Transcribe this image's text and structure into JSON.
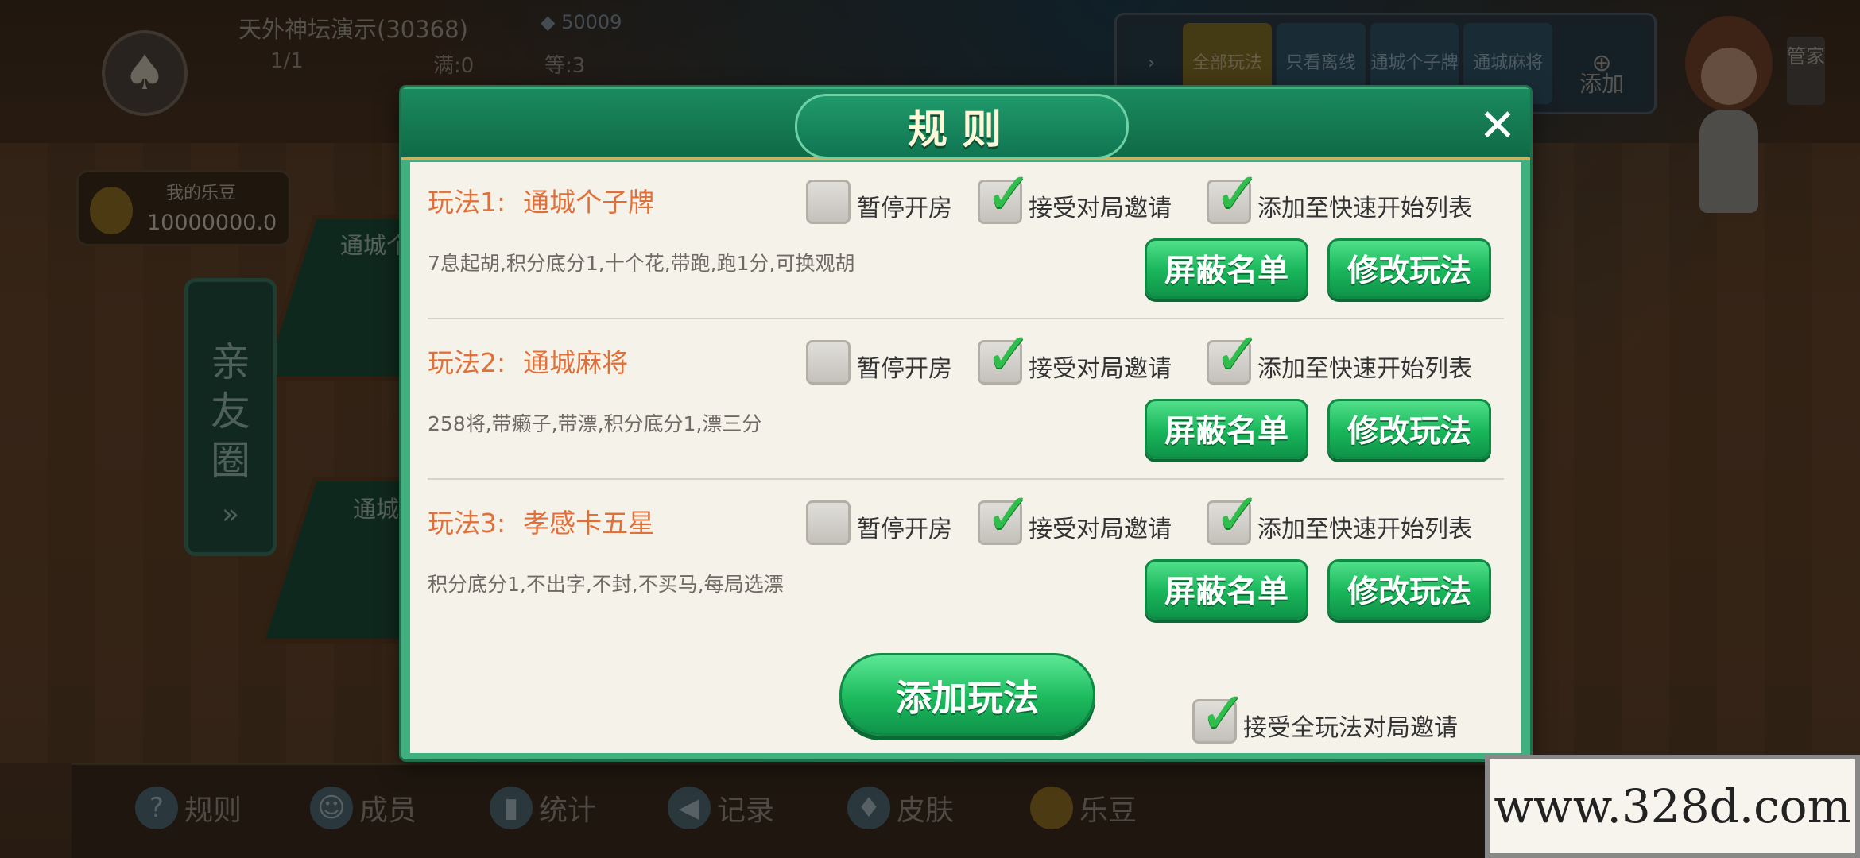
{
  "background": {
    "room_title": "天外神坛演示(30368)",
    "members_count": "1/1",
    "full_status": "满:0",
    "waiting_status": "等:3",
    "diamonds": "50009",
    "beans_label": "我的乐豆",
    "beans_value": "10000000.0",
    "circle_tab": "亲友圈",
    "table_labels": [
      "通城个",
      "通城"
    ],
    "top_tabs": [
      "全部玩法",
      "只看离线",
      "通城个子牌",
      "通城麻将"
    ],
    "top_add_label": "添加",
    "butler_label": "管家"
  },
  "bottom_nav": [
    {
      "label": "规则",
      "icon": "question-icon"
    },
    {
      "label": "成员",
      "icon": "members-icon"
    },
    {
      "label": "统计",
      "icon": "stats-icon"
    },
    {
      "label": "记录",
      "icon": "record-icon"
    },
    {
      "label": "皮肤",
      "icon": "skin-icon"
    },
    {
      "label": "乐豆",
      "icon": "bean-icon"
    }
  ],
  "watermark": "www.328d.com",
  "modal": {
    "title": "规则",
    "close_symbol": "✕",
    "rules": [
      {
        "index_label": "玩法1:",
        "game_name": "通城个子牌",
        "description": "7息起胡,积分底分1,十个花,带跑,跑1分,可换观胡",
        "pause_label": "暂停开房",
        "pause_checked": false,
        "accept_invite_label": "接受对局邀请",
        "accept_invite_checked": true,
        "quick_start_label": "添加至快速开始列表",
        "quick_start_checked": true,
        "block_label": "屏蔽名单",
        "edit_label": "修改玩法"
      },
      {
        "index_label": "玩法2:",
        "game_name": "通城麻将",
        "description": "258将,带癞子,带漂,积分底分1,漂三分",
        "pause_label": "暂停开房",
        "pause_checked": false,
        "accept_invite_label": "接受对局邀请",
        "accept_invite_checked": true,
        "quick_start_label": "添加至快速开始列表",
        "quick_start_checked": true,
        "block_label": "屏蔽名单",
        "edit_label": "修改玩法"
      },
      {
        "index_label": "玩法3:",
        "game_name": "孝感卡五星",
        "description": "积分底分1,不出字,不封,不买马,每局选漂",
        "pause_label": "暂停开房",
        "pause_checked": false,
        "accept_invite_label": "接受对局邀请",
        "accept_invite_checked": true,
        "quick_start_label": "添加至快速开始列表",
        "quick_start_checked": true,
        "block_label": "屏蔽名单",
        "edit_label": "修改玩法"
      }
    ],
    "add_rule_label": "添加玩法",
    "accept_all_label": "接受全玩法对局邀请",
    "accept_all_checked": true
  }
}
